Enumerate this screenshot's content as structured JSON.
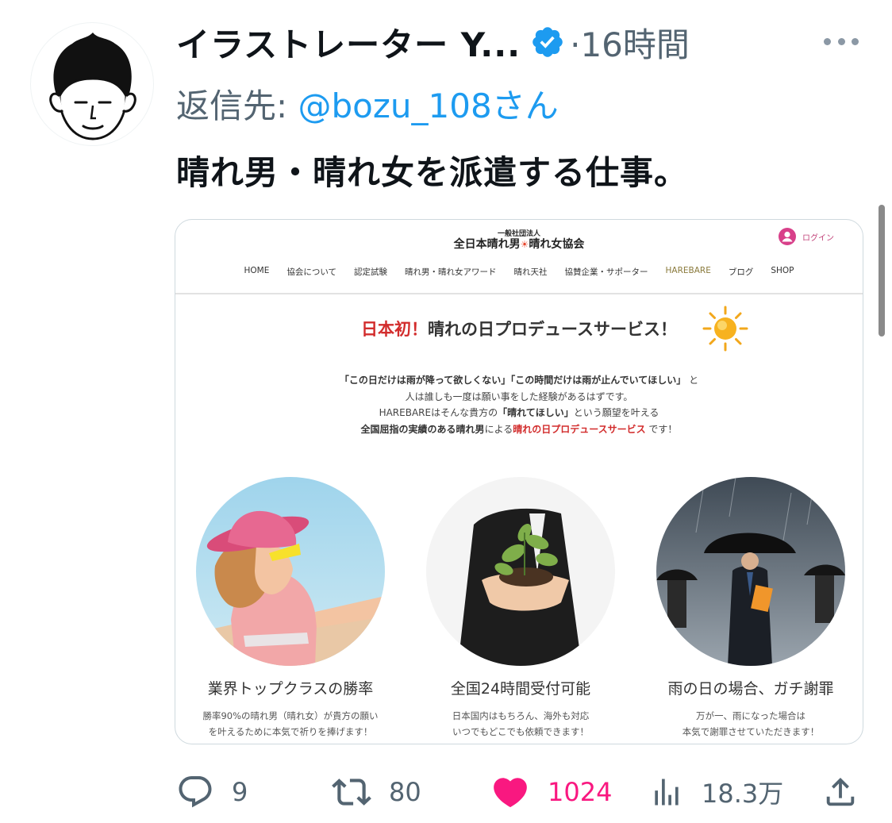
{
  "tweet": {
    "author_name": "イラストレーター Y...",
    "verified_icon": "verified-badge-icon",
    "time": "·16時間",
    "reply_prefix": "返信先: ",
    "reply_handle": "@bozu_108さん",
    "text": "晴れ男・晴れ女を派遣する仕事。"
  },
  "card": {
    "site_sub": "一般社団法人",
    "site_title_a": "全日本晴れ男",
    "site_title_b": "晴れ女協会",
    "login_label": "ログイン",
    "nav": [
      "HOME",
      "協会について",
      "認定試験",
      "晴れ男・晴れ女アワード",
      "晴れ天社",
      "協賛企業・サポーター",
      "HAREBARE",
      "ブログ",
      "SHOP"
    ],
    "headline_red": "日本初！",
    "headline_rest": "晴れの日プロデュースサービス！",
    "intro": {
      "line1_a": "「この日だけは雨が降って欲しくない」「この時間だけは雨が止んでいてほしい」",
      "line1_b": " と",
      "line2": "人は誰しも一度は願い事をした経験があるはずです。",
      "line3_a": "HAREBAREはそんな貴方の",
      "line3_b": "「晴れてほしい」",
      "line3_c": "という願望を叶える",
      "line4_a": "全国屈指の実績のある晴れ男",
      "line4_b": "による",
      "line4_c": "晴れの日プロデュースサービス",
      "line4_d": " です！"
    },
    "features": [
      {
        "title": "業界トップクラスの勝率",
        "desc1": "勝率90%の晴れ男（晴れ女）が貴方の願い",
        "desc2": "を叶えるために本気で祈りを捧げます！"
      },
      {
        "title": "全国24時間受付可能",
        "desc1": "日本国内はもちろん、海外も対応",
        "desc2": "いつでもどこでも依頼できます！"
      },
      {
        "title": "雨の日の場合、ガチ謝罪",
        "desc1": "万が一、雨になった場合は",
        "desc2": "本気で謝罪させていただきます！"
      }
    ]
  },
  "actions": {
    "reply_count": "9",
    "retweet_count": "80",
    "like_count": "1024",
    "views_count": "18.3万"
  },
  "colors": {
    "accent": "#1d9bf0",
    "like": "#f91880",
    "muted": "#536471",
    "site_red": "#d22c2c"
  }
}
